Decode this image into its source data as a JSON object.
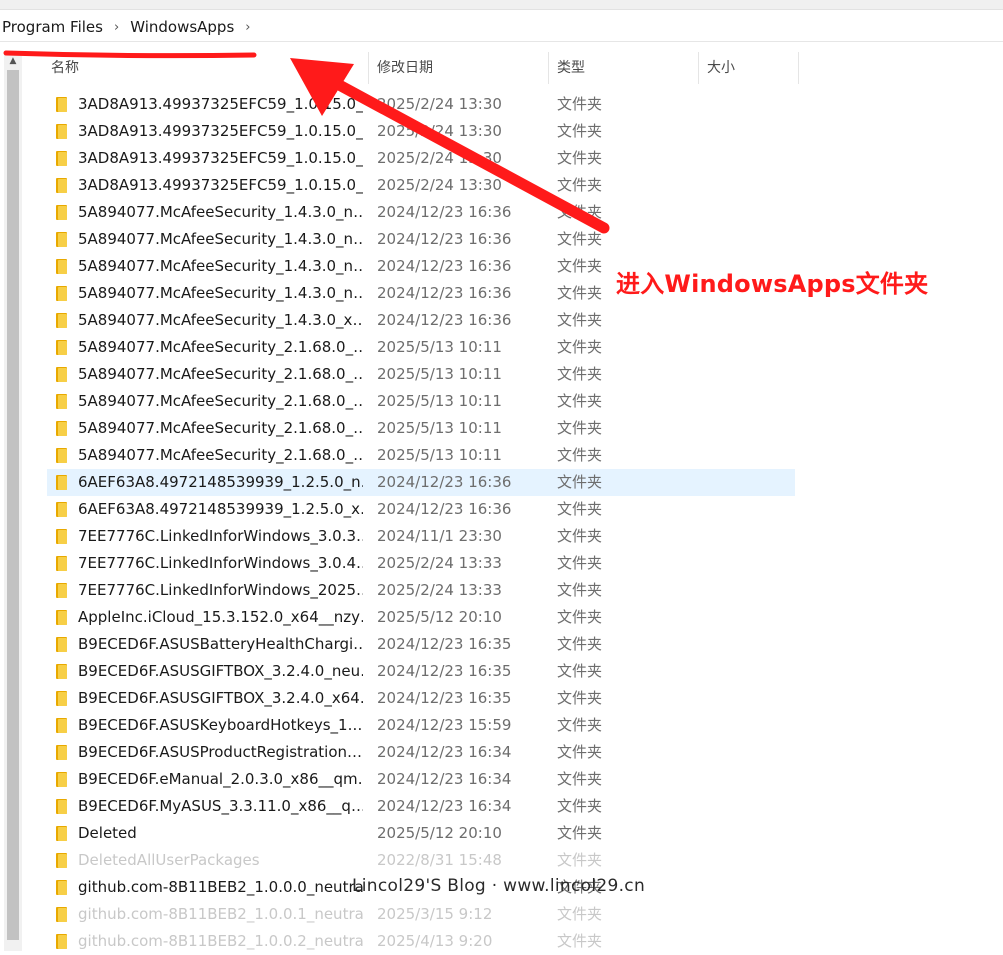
{
  "breadcrumb": {
    "items": [
      "Program Files",
      "WindowsApps"
    ],
    "separator_glyph": "›",
    "trailing_chevron": "›"
  },
  "columns": {
    "name": "名称",
    "date": "修改日期",
    "type": "类型",
    "size": "大小"
  },
  "files": [
    {
      "name": "3AD8A913.49937325EFC59_1.0.15.0_…",
      "date": "2025/2/24 13:30",
      "type": "文件夹"
    },
    {
      "name": "3AD8A913.49937325EFC59_1.0.15.0_…",
      "date": "2025/2/24 13:30",
      "type": "文件夹"
    },
    {
      "name": "3AD8A913.49937325EFC59_1.0.15.0_…",
      "date": "2025/2/24 13:30",
      "type": "文件夹"
    },
    {
      "name": "3AD8A913.49937325EFC59_1.0.15.0_…",
      "date": "2025/2/24 13:30",
      "type": "文件夹"
    },
    {
      "name": "5A894077.McAfeeSecurity_1.4.3.0_n…",
      "date": "2024/12/23 16:36",
      "type": "文件夹"
    },
    {
      "name": "5A894077.McAfeeSecurity_1.4.3.0_n…",
      "date": "2024/12/23 16:36",
      "type": "文件夹"
    },
    {
      "name": "5A894077.McAfeeSecurity_1.4.3.0_n…",
      "date": "2024/12/23 16:36",
      "type": "文件夹"
    },
    {
      "name": "5A894077.McAfeeSecurity_1.4.3.0_n…",
      "date": "2024/12/23 16:36",
      "type": "文件夹"
    },
    {
      "name": "5A894077.McAfeeSecurity_1.4.3.0_x…",
      "date": "2024/12/23 16:36",
      "type": "文件夹"
    },
    {
      "name": "5A894077.McAfeeSecurity_2.1.68.0_…",
      "date": "2025/5/13 10:11",
      "type": "文件夹"
    },
    {
      "name": "5A894077.McAfeeSecurity_2.1.68.0_…",
      "date": "2025/5/13 10:11",
      "type": "文件夹"
    },
    {
      "name": "5A894077.McAfeeSecurity_2.1.68.0_…",
      "date": "2025/5/13 10:11",
      "type": "文件夹"
    },
    {
      "name": "5A894077.McAfeeSecurity_2.1.68.0_…",
      "date": "2025/5/13 10:11",
      "type": "文件夹"
    },
    {
      "name": "5A894077.McAfeeSecurity_2.1.68.0_…",
      "date": "2025/5/13 10:11",
      "type": "文件夹"
    },
    {
      "name": "6AEF63A8.4972148539939_1.2.5.0_n…",
      "date": "2024/12/23 16:36",
      "type": "文件夹",
      "selected": true
    },
    {
      "name": "6AEF63A8.4972148539939_1.2.5.0_x…",
      "date": "2024/12/23 16:36",
      "type": "文件夹"
    },
    {
      "name": "7EE7776C.LinkedInforWindows_3.0.3…",
      "date": "2024/11/1 23:30",
      "type": "文件夹"
    },
    {
      "name": "7EE7776C.LinkedInforWindows_3.0.4…",
      "date": "2025/2/24 13:33",
      "type": "文件夹"
    },
    {
      "name": "7EE7776C.LinkedInforWindows_2025…",
      "date": "2025/2/24 13:33",
      "type": "文件夹"
    },
    {
      "name": "AppleInc.iCloud_15.3.152.0_x64__nzy…",
      "date": "2025/5/12 20:10",
      "type": "文件夹"
    },
    {
      "name": "B9ECED6F.ASUSBatteryHealthChargi…",
      "date": "2024/12/23 16:35",
      "type": "文件夹"
    },
    {
      "name": "B9ECED6F.ASUSGIFTBOX_3.2.4.0_neu…",
      "date": "2024/12/23 16:35",
      "type": "文件夹"
    },
    {
      "name": "B9ECED6F.ASUSGIFTBOX_3.2.4.0_x64…",
      "date": "2024/12/23 16:35",
      "type": "文件夹"
    },
    {
      "name": "B9ECED6F.ASUSKeyboardHotkeys_1.…",
      "date": "2024/12/23 15:59",
      "type": "文件夹"
    },
    {
      "name": "B9ECED6F.ASUSProductRegistration…",
      "date": "2024/12/23 16:34",
      "type": "文件夹"
    },
    {
      "name": "B9ECED6F.eManual_2.0.3.0_x86__qm…",
      "date": "2024/12/23 16:34",
      "type": "文件夹"
    },
    {
      "name": "B9ECED6F.MyASUS_3.3.11.0_x86__q…",
      "date": "2024/12/23 16:34",
      "type": "文件夹"
    },
    {
      "name": "Deleted",
      "date": "2025/5/12 20:10",
      "type": "文件夹"
    },
    {
      "name": "DeletedAllUserPackages",
      "date": "2022/8/31 15:48",
      "type": "文件夹",
      "dim": true
    },
    {
      "name": "github.com-8B11BEB2_1.0.0.0_neutra…",
      "date": "",
      "type": "文件夹"
    },
    {
      "name": "github.com-8B11BEB2_1.0.0.1_neutra…",
      "date": "2025/3/15 9:12",
      "type": "文件夹",
      "dim": true
    },
    {
      "name": "github.com-8B11BEB2_1.0.0.2_neutra…",
      "date": "2025/4/13 9:20",
      "type": "文件夹",
      "dim": true
    }
  ],
  "annotation": {
    "text": "进入WindowsApps文件夹",
    "color": "#ff1a1a"
  },
  "watermark": {
    "text": "Lincol29'S Blog · www.lincol29.cn"
  },
  "colors": {
    "folder": "#f7cf47",
    "selection": "#e5f3ff",
    "annotation": "#ff1a1a"
  }
}
